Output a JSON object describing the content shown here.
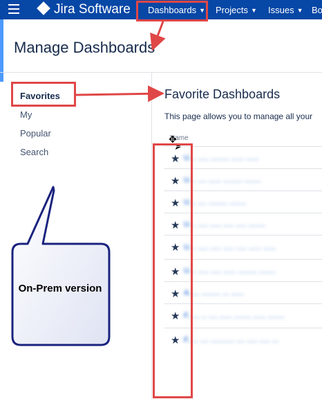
{
  "topbar": {
    "app_name": "Jira Software",
    "nav": [
      {
        "label": "Dashboards"
      },
      {
        "label": "Projects"
      },
      {
        "label": "Issues"
      },
      {
        "label": "Bo"
      }
    ],
    "background": "#0747a6"
  },
  "page": {
    "title": "Manage Dashboards"
  },
  "sidebar": {
    "items": [
      {
        "label": "Favorites",
        "active": true
      },
      {
        "label": "My"
      },
      {
        "label": "Popular"
      },
      {
        "label": "Search"
      }
    ]
  },
  "main": {
    "title": "Favorite Dashboards",
    "description": "This page allows you to manage all your",
    "column_header": "Name",
    "rows": [
      {
        "name": "U... ..... ......... ...... ......",
        "blurred": true
      },
      {
        "name": "U... .... ...... ......... ........",
        "blurred": true
      },
      {
        "name": "U... .... ......... ........",
        "blurred": true
      },
      {
        "name": "U... ..... ..... ..... ..... ........",
        "blurred": true
      },
      {
        "name": "U... ..... ..... ..... ..... ...... ......",
        "blurred": true
      },
      {
        "name": "U... ..... ..... ...... ......... ........",
        "blurred": true
      },
      {
        "name": "A..... ......... ... ......",
        "blurred": true
      },
      {
        "name": "F...... .. .... ...... ........ ...... ........",
        "blurred": true
      },
      {
        "name": "F..... .... ........... .... ..... ..... ...",
        "blurred": true
      }
    ]
  },
  "annotation": {
    "callout_text": "On-Prem version",
    "highlight_color": "#e04747",
    "callout_border": "#1a237e"
  }
}
